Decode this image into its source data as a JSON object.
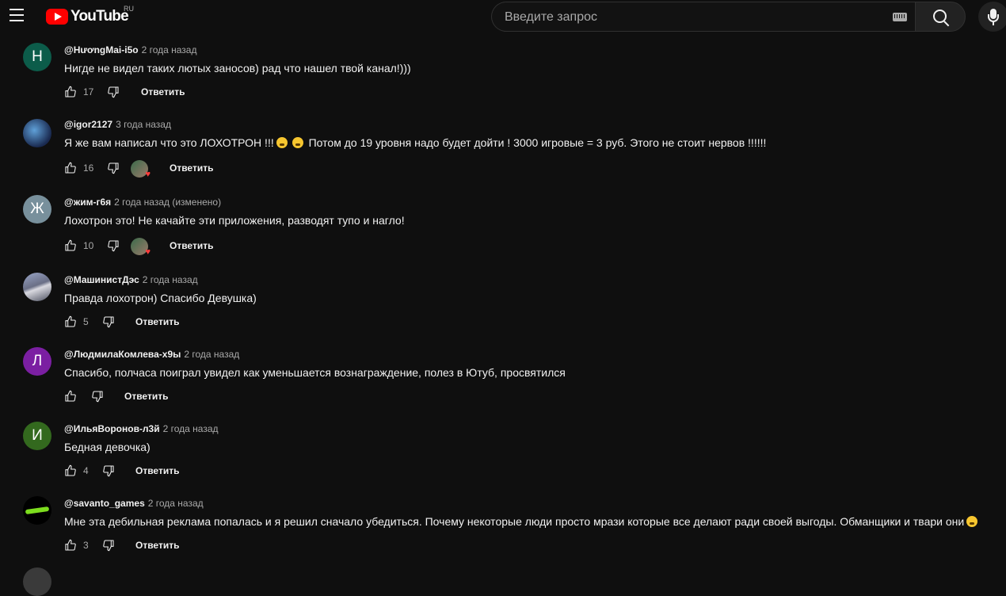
{
  "header": {
    "logo_text": "YouTube",
    "country_code": "RU",
    "search_placeholder": "Введите запрос"
  },
  "comments": [
    {
      "author": "@HươngMai-i5o",
      "time": "2 года назад",
      "text": "Нигде не видел таких лютых заносов) рад что нашел твой канал!)))",
      "likes": "17",
      "avatar_letter": "Н",
      "avatar_color": "#0c5c4a",
      "creator_heart": false,
      "reply_label": "Ответить"
    },
    {
      "author": "@igor2127",
      "time": "3 года назад",
      "text_parts": [
        "Я же вам написал что это ЛОХОТРОН !!!",
        " Потом до 19 уровня надо будет дойти ! 3000 игровые = 3 руб. Этого не стоит нервов !!!!!!"
      ],
      "likes": "16",
      "avatar_letter": "",
      "avatar_color": "#2a4a7a",
      "creator_heart": true,
      "reply_label": "Ответить"
    },
    {
      "author": "@жим-г6я",
      "time": "2 года назад (изменено)",
      "text": "Лохотрон это! Не качайте эти приложения, разводят тупо и нагло!",
      "likes": "10",
      "avatar_letter": "Ж",
      "avatar_color": "#78909c",
      "creator_heart": true,
      "reply_label": "Ответить"
    },
    {
      "author": "@МашинистДэс",
      "time": "2 года назад",
      "text": "Правда лохотрон) Спасибо Девушка)",
      "likes": "5",
      "avatar_letter": "",
      "avatar_color": "#6a6f86",
      "creator_heart": false,
      "reply_label": "Ответить"
    },
    {
      "author": "@ЛюдмилаКомлева-х9ы",
      "time": "2 года назад",
      "text": "Спасибо, полчаса поиграл увидел как уменьшается вознаграждение, полез в Ютуб, просвятился",
      "likes": "",
      "avatar_letter": "Л",
      "avatar_color": "#7b1fa2",
      "creator_heart": false,
      "reply_label": "Ответить"
    },
    {
      "author": "@ИльяВоронов-л3й",
      "time": "2 года назад",
      "text": "Бедная девочка)",
      "likes": "4",
      "avatar_letter": "И",
      "avatar_color": "#33691e",
      "creator_heart": false,
      "reply_label": "Ответить"
    },
    {
      "author": "@savanto_games",
      "time": "2 года назад",
      "text": "Мне эта дебильная реклама попалась и я решил сначало убедиться. Почему некоторые люди просто мрази которые все делают ради своей выгоды. Обманщики и твари они",
      "likes": "3",
      "avatar_letter": "",
      "avatar_color": "#000000",
      "creator_heart": false,
      "reply_label": "Ответить"
    }
  ]
}
